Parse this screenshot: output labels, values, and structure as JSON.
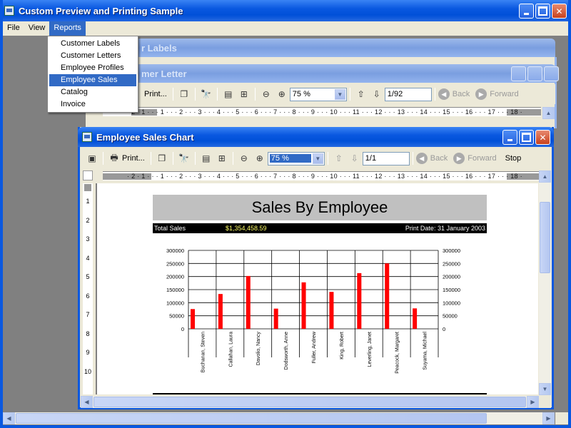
{
  "app": {
    "title": "Custom Preview and Printing Sample"
  },
  "menu": {
    "items": [
      "File",
      "View",
      "Reports"
    ],
    "reports_items": [
      "Customer Labels",
      "Customer Letters",
      "Employee Profiles",
      "Employee Sales",
      "Catalog",
      "Invoice"
    ],
    "highlighted": "Employee Sales"
  },
  "bg_windows": {
    "labels_title": "r Labels",
    "letter_title": "mer Letter",
    "letter_toolbar": {
      "print_label": "Print...",
      "zoom": "75 %",
      "page": "1/92",
      "back_label": "Back",
      "forward_label": "Forward"
    }
  },
  "sales_window": {
    "title": "Employee Sales Chart",
    "toolbar": {
      "print_label": "Print...",
      "zoom": "75 %",
      "page": "1/1",
      "back_label": "Back",
      "forward_label": "Forward",
      "stop_label": "Stop"
    }
  },
  "ruler": {
    "text": "· 2 · 1 · · · 1 · · · 2 · · · 3 · · · 4 · · · 5 · · · 6 · · · 7 · · · 8 · · · 9 · · · 10 · · · 11 · · · 12 · · · 13 · · · 14 · · · 15 · · · 16 · · · 17 · · · 18 ·"
  },
  "vruler": {
    "labels": [
      "1",
      "2",
      "3",
      "4",
      "5",
      "6",
      "7",
      "8",
      "9",
      "10"
    ]
  },
  "report": {
    "title": "Sales By Employee",
    "total_label": "Total Sales",
    "total_value": "$1,354,458.59",
    "print_date": "Print Date: 31 January 2003"
  },
  "chart_data": {
    "type": "bar",
    "categories": [
      "Buchanan, Steven",
      "Callahan, Laura",
      "Davolio, Nancy",
      "Dodsworth, Anne",
      "Fuller, Andrew",
      "King, Robert",
      "Leverling, Janet",
      "Peacock, Margaret",
      "Suyama, Michael"
    ],
    "values": [
      75568,
      133302,
      202143,
      77308,
      177749,
      141296,
      213051,
      250187,
      78198
    ],
    "ylim": [
      0,
      300000
    ],
    "yticks": [
      "300000",
      "250000",
      "200000",
      "150000",
      "100000",
      "50000",
      "0"
    ],
    "color": "#ff0000",
    "grid": true
  }
}
